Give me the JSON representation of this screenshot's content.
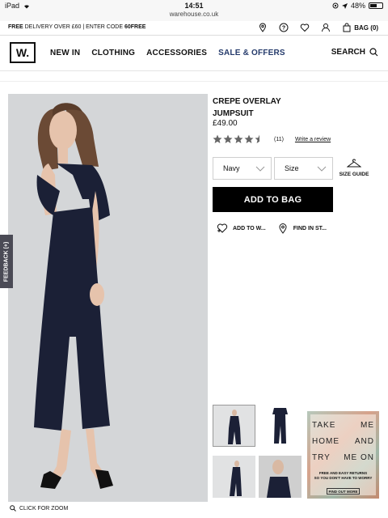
{
  "status_bar": {
    "device": "iPad",
    "time": "14:51",
    "url": "warehouse.co.uk",
    "battery": "48%"
  },
  "promo": {
    "text_a": "FREE",
    "text_b": " DELIVERY OVER £60 | ENTER CODE ",
    "code": "60FREE",
    "bag": "BAG (0)"
  },
  "nav": {
    "logo": "W.",
    "items": [
      "NEW IN",
      "CLOTHING",
      "ACCESSORIES",
      "SALE & OFFERS"
    ],
    "search": "SEARCH"
  },
  "product": {
    "title_line1": "CREPE OVERLAY",
    "title_line2": "JUMPSUIT",
    "price": "£49.00",
    "rating": 4.5,
    "review_count": "(11)",
    "write_review": "Write a review",
    "colour": "Navy",
    "size": "Size",
    "size_guide": "SIZE GUIDE",
    "add_to_bag": "ADD TO BAG",
    "add_to_wishlist": "ADD TO W...",
    "find_in_store": "FIND IN ST..."
  },
  "feedback": "FEEDBACK (+)",
  "zoom": "CLICK FOR ZOOM",
  "promo_tile": {
    "line1_a": "TAKE",
    "line1_b": "ME",
    "line2_a": "HOME",
    "line2_b": "AND",
    "line3_a": "TRY",
    "line3_b": "ME ON",
    "small1": "FREE AND EASY RETURNS",
    "small2": "SO YOU DON'T HAVE TO WORRY",
    "button": "FIND OUT MORE"
  }
}
